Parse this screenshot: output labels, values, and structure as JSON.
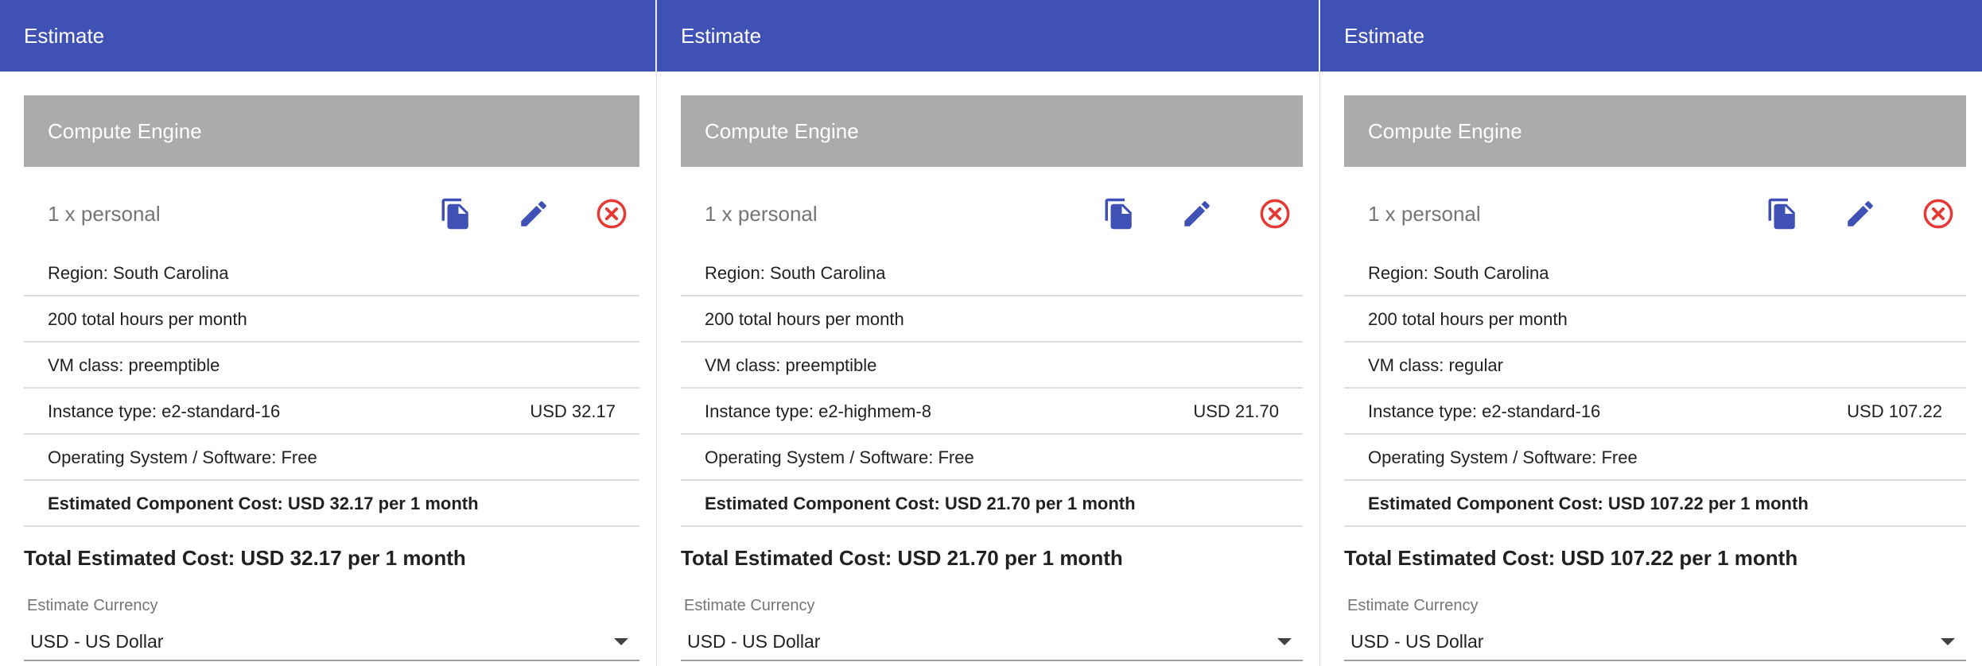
{
  "estimates": [
    {
      "header_title": "Estimate",
      "section_title": "Compute Engine",
      "item_title": "1 x personal",
      "region": "Region: South Carolina",
      "hours": "200 total hours per month",
      "vm_class": "VM class: preemptible",
      "instance_type": "Instance type: e2-standard-16",
      "instance_price": "USD 32.17",
      "os": "Operating System / Software: Free",
      "component_cost": "Estimated Component Cost: USD 32.17 per 1 month",
      "total": "Total Estimated Cost: USD 32.17 per 1 month",
      "currency_label": "Estimate Currency",
      "currency_value": "USD - US Dollar"
    },
    {
      "header_title": "Estimate",
      "section_title": "Compute Engine",
      "item_title": "1 x personal",
      "region": "Region: South Carolina",
      "hours": "200 total hours per month",
      "vm_class": "VM class: preemptible",
      "instance_type": "Instance type: e2-highmem-8",
      "instance_price": "USD 21.70",
      "os": "Operating System / Software: Free",
      "component_cost": "Estimated Component Cost: USD 21.70 per 1 month",
      "total": "Total Estimated Cost: USD 21.70 per 1 month",
      "currency_label": "Estimate Currency",
      "currency_value": "USD - US Dollar"
    },
    {
      "header_title": "Estimate",
      "section_title": "Compute Engine",
      "item_title": "1 x personal",
      "region": "Region: South Carolina",
      "hours": "200 total hours per month",
      "vm_class": "VM class: regular",
      "instance_type": "Instance type: e2-standard-16",
      "instance_price": "USD 107.22",
      "os": "Operating System / Software: Free",
      "component_cost": "Estimated Component Cost: USD 107.22 per 1 month",
      "total": "Total Estimated Cost: USD 107.22 per 1 month",
      "currency_label": "Estimate Currency",
      "currency_value": "USD - US Dollar"
    }
  ],
  "icons": {
    "copy": "copy-icon",
    "edit": "edit-icon",
    "remove": "remove-icon"
  },
  "colors": {
    "header": "#3f51b5",
    "section": "#ababab",
    "action_icon": "#3f51b5",
    "remove_icon": "#e53935"
  }
}
